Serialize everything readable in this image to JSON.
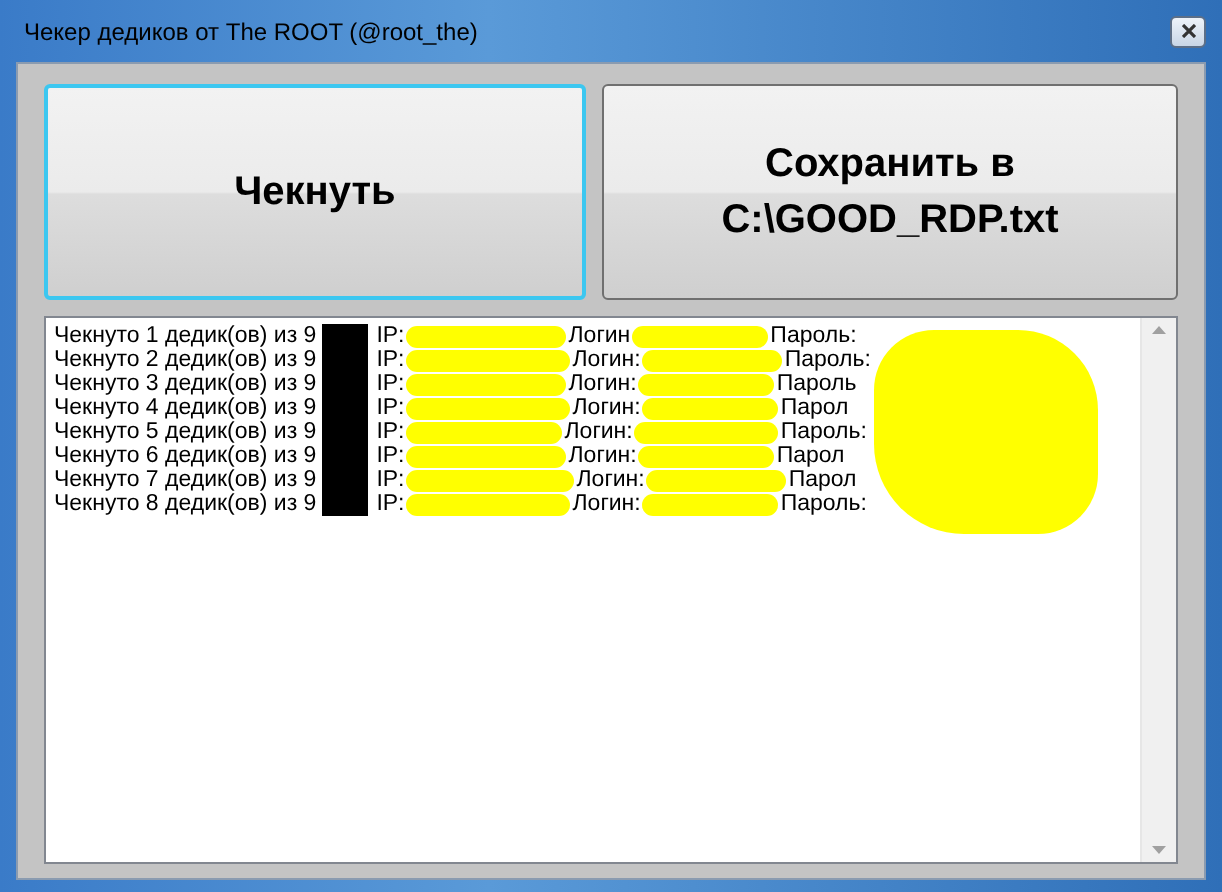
{
  "window": {
    "title": "Чекер дедиков от The ROOT (@root_the)"
  },
  "buttons": [
    {
      "label": "Чекнуть",
      "focused": true
    },
    {
      "label": "Сохранить в C:\\GOOD_RDP.txt",
      "focused": false
    }
  ],
  "log": {
    "lines": [
      {
        "status": "Чекнуто 1 дедик(ов) из 9",
        "ip": "IP:",
        "login": "Логин",
        "password": "Пароль:"
      },
      {
        "status": "Чекнуто 2 дедик(ов) из 9",
        "ip": "IP:",
        "login": "Логин:",
        "password": "Пароль:"
      },
      {
        "status": "Чекнуто 3 дедик(ов) из 9",
        "ip": "IP:",
        "login": "Логин:",
        "password": "Пароль"
      },
      {
        "status": "Чекнуто 4 дедик(ов) из 9",
        "ip": "IP:",
        "login": "Логин:",
        "password": "Парол"
      },
      {
        "status": "Чекнуто 5 дедик(ов) из 9",
        "ip": "IP:",
        "login": "Логин:",
        "password": "Пароль:"
      },
      {
        "status": "Чекнуто 6 дедик(ов) из 9",
        "ip": "IP:",
        "login": "Логин:",
        "password": "Парол"
      },
      {
        "status": "Чекнуто 7 дедик(ов) из 9",
        "ip": "IP:",
        "login": "Логин:",
        "password": "Парол"
      },
      {
        "status": "Чекнуто 8 дедик(ов) из 9",
        "ip": "IP:",
        "login": "Логин:",
        "password": "Пароль:"
      }
    ]
  }
}
